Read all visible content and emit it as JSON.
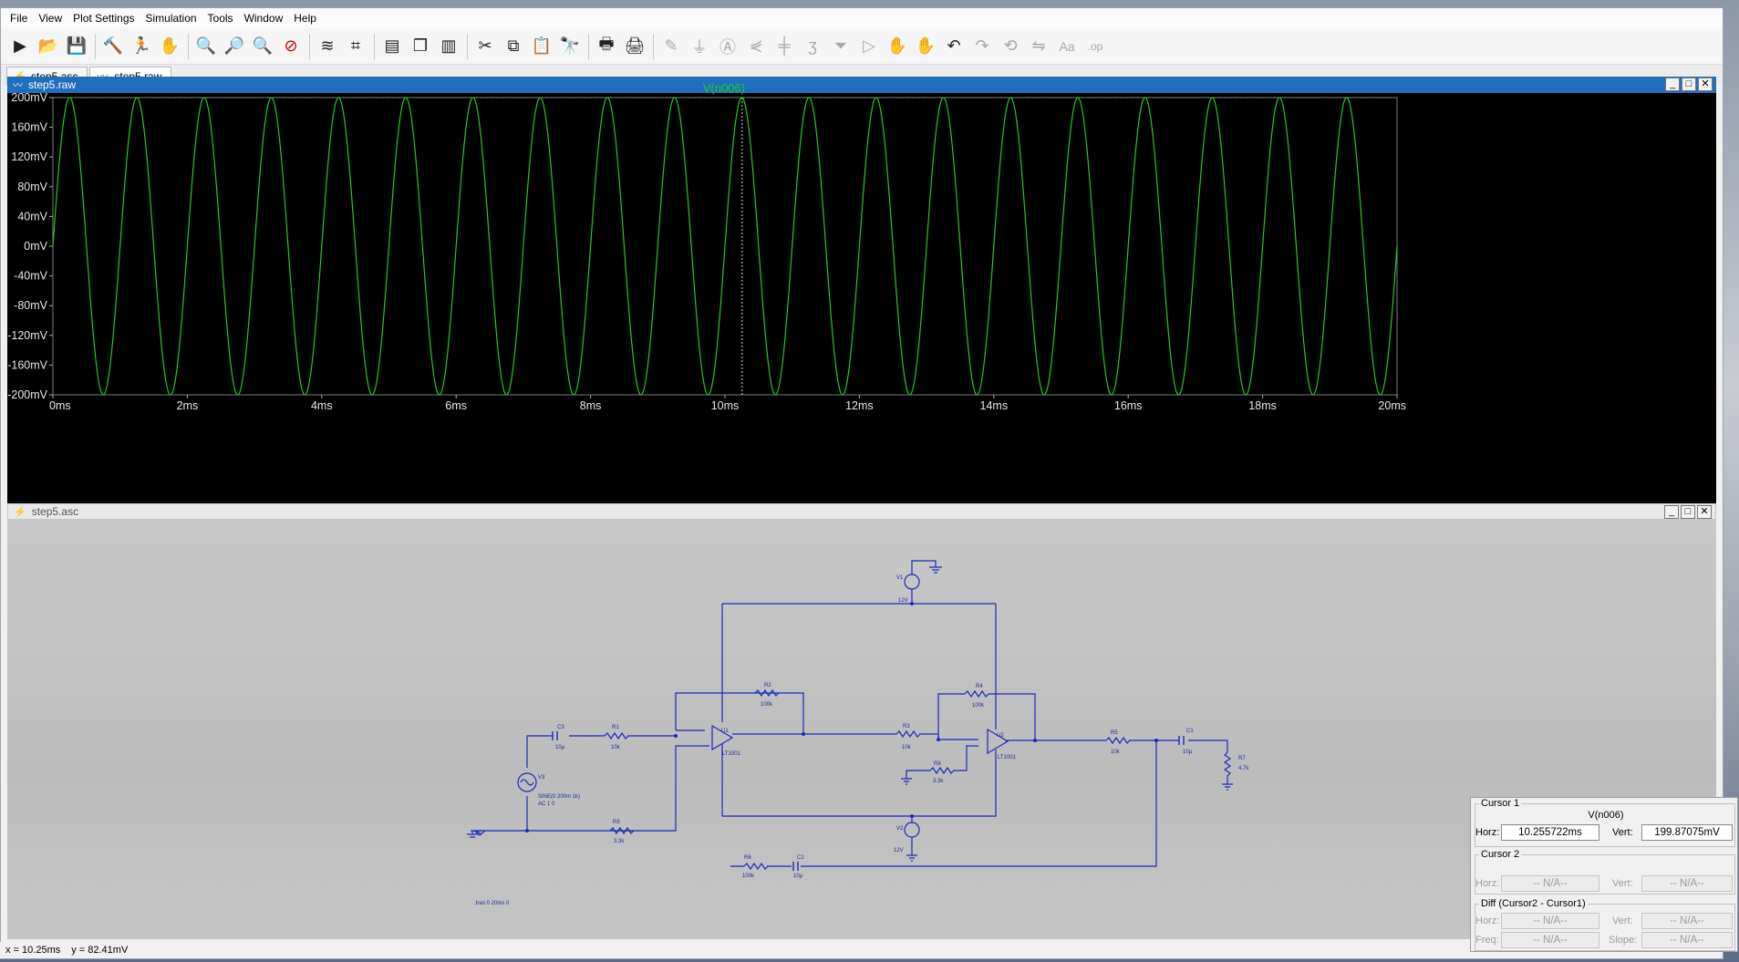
{
  "menu": [
    "File",
    "View",
    "Plot Settings",
    "Simulation",
    "Tools",
    "Window",
    "Help"
  ],
  "toolbar": {
    "icons": [
      "run-icon",
      "open-icon",
      "save-icon",
      "control-panel-icon",
      "halt-icon",
      "pan-icon",
      "zoom-in-icon",
      "zoom-full-icon",
      "zoom-out-icon",
      "zoom-cancel-icon",
      "autorange-icon",
      "mark-icon",
      "tile-horizontal-icon",
      "cascade-icon",
      "tile-vertical-icon",
      "cut-icon",
      "copy-icon",
      "paste-icon",
      "find-icon",
      "print-icon",
      "print-setup-icon",
      "wire-icon",
      "ground-icon",
      "label-icon",
      "resistor-icon",
      "capacitor-icon",
      "inductor-icon",
      "diode-icon",
      "component-icon",
      "move-icon",
      "drag-icon",
      "undo-icon",
      "redo-icon",
      "rotate-icon",
      "mirror-icon",
      "text-icon",
      "spice-directive-icon"
    ]
  },
  "tabs": [
    {
      "label": "step5.asc",
      "icon": "schematic-icon"
    },
    {
      "label": "step5.raw",
      "icon": "waveform-icon"
    }
  ],
  "plot_window": {
    "title": "step5.raw",
    "trace_label": "V(n006)",
    "trace_color": "#22cc22"
  },
  "chart_data": {
    "type": "line",
    "title": "",
    "series": [
      {
        "name": "V(n006)",
        "amplitude_mV": 200,
        "frequency_Hz": 1000,
        "offset_mV": 0
      }
    ],
    "x_tick_labels": [
      "0ms",
      "2ms",
      "4ms",
      "6ms",
      "8ms",
      "10ms",
      "12ms",
      "14ms",
      "16ms",
      "18ms",
      "20ms"
    ],
    "y_tick_labels": [
      "200mV",
      "160mV",
      "120mV",
      "80mV",
      "40mV",
      "0mV",
      "-40mV",
      "-80mV",
      "-120mV",
      "-160mV",
      "-200mV"
    ],
    "xlim_ms": [
      0,
      20
    ],
    "ylim_mV": [
      -200,
      200
    ],
    "cursor_x_ms": 10.255722,
    "grid": false
  },
  "schematic_window": {
    "title": "step5.asc"
  },
  "schematic": {
    "labels": {
      "V1": "V1",
      "V1_val": "12V",
      "V2": "V2",
      "V2_val": "12V",
      "V3": "V3",
      "V3_val1": "SINE(0 200m 1k)",
      "V3_val2": "AC 1 0",
      "C1": "C1",
      "C1_val": "10µ",
      "C2": "C2",
      "C2_val": "10µ",
      "C3": "C3",
      "C3_val": "10µ",
      "R1": "R1",
      "R1_val": "10k",
      "R2": "R2",
      "R2_val": "100k",
      "R3": "R3",
      "R3_val": "10k",
      "R4": "R4",
      "R4_val": "100k",
      "R5": "R5",
      "R5_val": "10k",
      "R6": "R6",
      "R6_val": "100k",
      "R7": "R7",
      "R7_val": "4.7k",
      "R8": "R8",
      "R8_val": "3.3k",
      "R9": "R9",
      "R9_val": "3.3k",
      "U1": "U1",
      "U1_val": "LT1001",
      "U2": "U2",
      "U2_val": "LT1001",
      "directive": ".tran 0 20ms 0"
    }
  },
  "cursor_panel": {
    "cursor1": {
      "title": "Cursor 1",
      "trace": "V(n006)",
      "horz_label": "Horz:",
      "horz": "10.255722ms",
      "vert_label": "Vert:",
      "vert": "199.87075mV"
    },
    "cursor2": {
      "title": "Cursor 2",
      "horz_label": "Horz:",
      "horz": "-- N/A--",
      "vert_label": "Vert:",
      "vert": "-- N/A--"
    },
    "diff": {
      "title": "Diff (Cursor2 - Cursor1)",
      "horz_label": "Horz:",
      "horz": "-- N/A--",
      "vert_label": "Vert:",
      "vert": "-- N/A--",
      "freq_label": "Freq:",
      "freq": "-- N/A--",
      "slope_label": "Slope:",
      "slope": "-- N/A--"
    }
  },
  "statusbar": {
    "x": "x = 10.25ms",
    "y": "y = 82.41mV"
  }
}
